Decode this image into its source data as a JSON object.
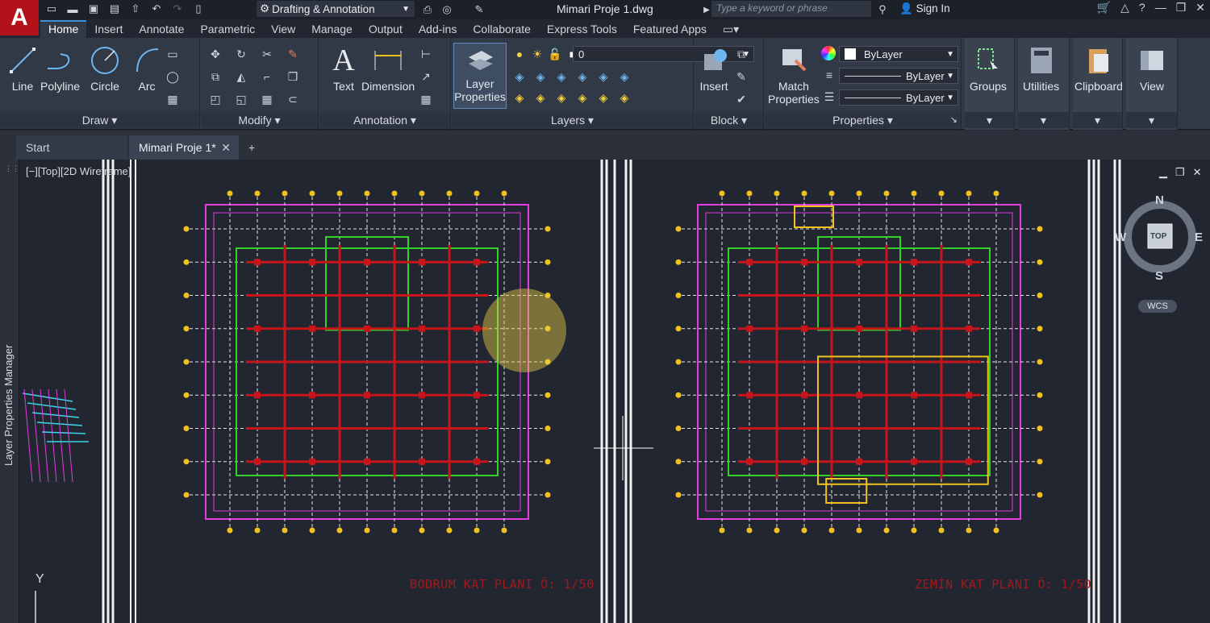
{
  "app": {
    "logo_letter": "A",
    "workspace": "Drafting & Annotation",
    "document_title": "Mimari Proje 1.dwg",
    "search_placeholder": "Type a keyword or phrase",
    "sign_in": "Sign In"
  },
  "ribbon_tabs": [
    "Home",
    "Insert",
    "Annotate",
    "Parametric",
    "View",
    "Manage",
    "Output",
    "Add-ins",
    "Collaborate",
    "Express Tools",
    "Featured Apps"
  ],
  "panels": {
    "draw": {
      "title": "Draw",
      "line": "Line",
      "polyline": "Polyline",
      "circle": "Circle",
      "arc": "Arc"
    },
    "modify": {
      "title": "Modify"
    },
    "annotation": {
      "title": "Annotation",
      "text": "Text",
      "dimension": "Dimension"
    },
    "layers": {
      "title": "Layers",
      "layer_properties_1": "Layer",
      "layer_properties_2": "Properties",
      "current_layer": "0"
    },
    "block": {
      "title": "Block",
      "insert": "Insert"
    },
    "properties": {
      "title": "Properties",
      "match_1": "Match",
      "match_2": "Properties",
      "color": "ByLayer",
      "linetype": "ByLayer",
      "lineweight": "ByLayer"
    },
    "groups": {
      "title": "Groups"
    },
    "utilities": {
      "title": "Utilities"
    },
    "clipboard": {
      "title": "Clipboard"
    },
    "view": {
      "title": "View"
    }
  },
  "document_tabs": {
    "start": "Start",
    "current": "Mimari Proje 1*"
  },
  "viewport": {
    "label": "[−][Top][2D Wireframe]",
    "palette_title": "Layer Properties Manager",
    "compass": {
      "north": "N",
      "south": "S",
      "east": "E",
      "west": "W",
      "face": "TOP"
    },
    "wcs": "WCS",
    "ucs_y": "Y"
  },
  "plans": {
    "left_title": "BODRUM KAT PLANI Ö: 1/50",
    "right_title": "ZEMİN KAT PLANI Ö: 1/50"
  },
  "colors": {
    "accent": "#3d8fd1",
    "grid_white": "#e6e6e6",
    "magenta": "#e23be0",
    "red": "#c8141b",
    "green": "#34d12a",
    "yellow": "#f2c21c"
  }
}
